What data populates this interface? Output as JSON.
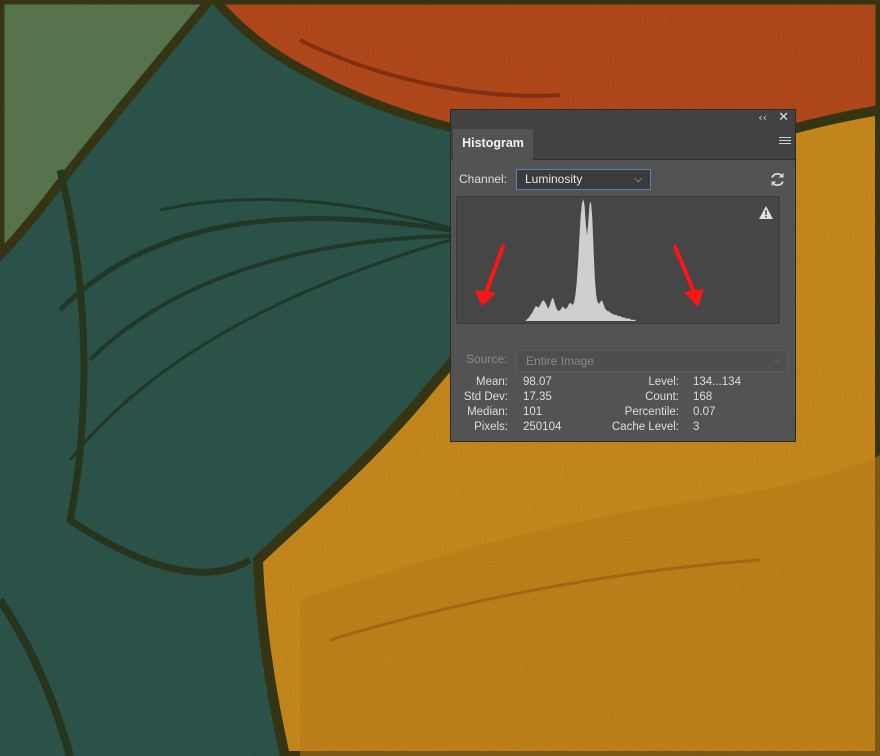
{
  "colors": {
    "teal": "#2f5a50",
    "green": "#5e7e55",
    "orange": "#bf4e1c",
    "gold": "#d4921e",
    "outline": "#3a3a16",
    "annotation_arrow": "#ff1414"
  },
  "panel": {
    "tab_title": "Histogram",
    "collapse_icon": "collapse-double-chevron-icon",
    "close_icon": "close-icon",
    "menu_icon": "panel-menu-icon",
    "channel": {
      "label": "Channel:",
      "value": "Luminosity"
    },
    "refresh_icon": "refresh-icon",
    "warning_icon": "warning-triangle-icon",
    "histogram_bins": [
      0,
      0,
      0,
      0,
      0,
      0,
      0,
      0,
      0,
      0,
      0,
      0,
      0,
      0,
      0,
      0,
      0,
      0,
      0,
      0,
      0,
      0,
      0,
      0,
      0,
      0,
      0,
      0,
      0,
      0,
      0,
      0,
      0,
      0,
      0,
      0,
      0,
      0,
      0,
      0,
      0,
      0,
      0,
      0,
      0,
      0,
      0,
      0,
      0,
      0,
      0,
      0,
      0,
      0,
      0.01,
      0.02,
      0.03,
      0.05,
      0.06,
      0.08,
      0.1,
      0.12,
      0.12,
      0.11,
      0.12,
      0.14,
      0.16,
      0.17,
      0.16,
      0.14,
      0.12,
      0.1,
      0.13,
      0.16,
      0.19,
      0.18,
      0.14,
      0.11,
      0.09,
      0.08,
      0.09,
      0.1,
      0.12,
      0.11,
      0.1,
      0.1,
      0.12,
      0.14,
      0.15,
      0.14,
      0.13,
      0.16,
      0.22,
      0.32,
      0.48,
      0.68,
      0.86,
      0.96,
      1.0,
      0.95,
      0.8,
      0.7,
      0.82,
      0.96,
      0.98,
      0.85,
      0.6,
      0.35,
      0.22,
      0.16,
      0.14,
      0.15,
      0.17,
      0.16,
      0.13,
      0.1,
      0.09,
      0.08,
      0.08,
      0.07,
      0.06,
      0.06,
      0.05,
      0.05,
      0.05,
      0.04,
      0.04,
      0.04,
      0.03,
      0.03,
      0.03,
      0.02,
      0.02,
      0.02,
      0.02,
      0.01,
      0.01,
      0.01,
      0.01,
      0,
      0,
      0,
      0,
      0,
      0,
      0,
      0,
      0,
      0,
      0,
      0,
      0,
      0,
      0,
      0,
      0,
      0,
      0,
      0,
      0,
      0,
      0,
      0,
      0,
      0,
      0,
      0,
      0,
      0,
      0,
      0,
      0,
      0,
      0,
      0,
      0,
      0,
      0,
      0,
      0,
      0,
      0,
      0,
      0,
      0,
      0,
      0,
      0,
      0,
      0,
      0,
      0,
      0,
      0,
      0,
      0,
      0,
      0,
      0,
      0,
      0,
      0,
      0,
      0,
      0,
      0,
      0,
      0,
      0,
      0,
      0,
      0,
      0,
      0,
      0,
      0,
      0,
      0,
      0,
      0,
      0,
      0,
      0,
      0,
      0,
      0,
      0,
      0,
      0,
      0,
      0,
      0,
      0,
      0,
      0,
      0,
      0,
      0,
      0,
      0,
      0,
      0,
      0,
      0,
      0,
      0,
      0,
      0,
      0,
      0,
      0
    ],
    "source": {
      "label": "Source:",
      "value": "Entire Image"
    },
    "stats": {
      "mean": {
        "label": "Mean:",
        "value": "98.07"
      },
      "std_dev": {
        "label": "Std Dev:",
        "value": "17.35"
      },
      "median": {
        "label": "Median:",
        "value": "101"
      },
      "pixels": {
        "label": "Pixels:",
        "value": "250104"
      },
      "level": {
        "label": "Level:",
        "value": "134...134"
      },
      "count": {
        "label": "Count:",
        "value": "168"
      },
      "percentile": {
        "label": "Percentile:",
        "value": "0.07"
      },
      "cache_level": {
        "label": "Cache Level:",
        "value": "3"
      }
    }
  }
}
